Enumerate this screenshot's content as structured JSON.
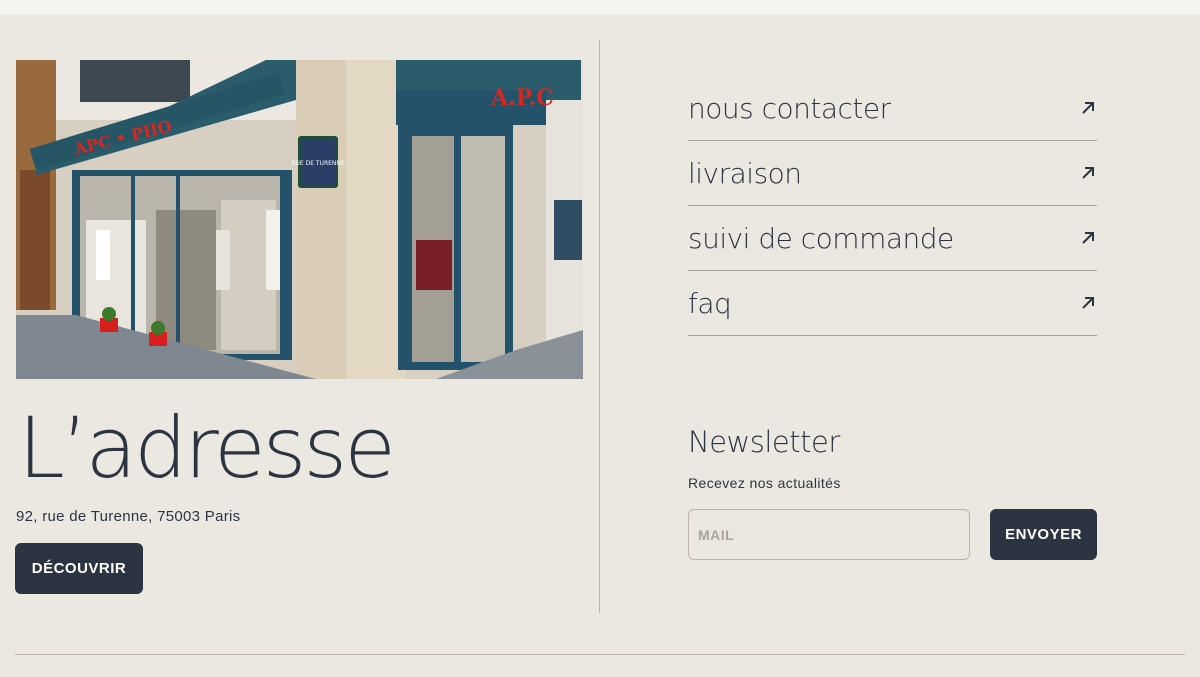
{
  "store": {
    "title": "L’adresse",
    "address": "92, rue de Turenne, 75003 Paris",
    "cta_label": "DÉCOUVRIR",
    "sign_left": "APC • PHO",
    "sign_right": "A.P.C",
    "street_sign": "RUE DE TURENNE"
  },
  "links": [
    {
      "label": "nous contacter",
      "icon": "arrow-up-right-icon"
    },
    {
      "label": "livraison",
      "icon": "arrow-up-right-icon"
    },
    {
      "label": "suivi de commande",
      "icon": "arrow-up-right-icon"
    },
    {
      "label": "faq",
      "icon": "arrow-up-right-icon"
    }
  ],
  "newsletter": {
    "title": "Newsletter",
    "subtitle": "Recevez nos actualités",
    "placeholder": "MAIL",
    "button_label": "ENVOYER"
  },
  "colors": {
    "background": "#ebe8e2",
    "primary_dark": "#2c3442",
    "divider": "#b9b3a9"
  }
}
